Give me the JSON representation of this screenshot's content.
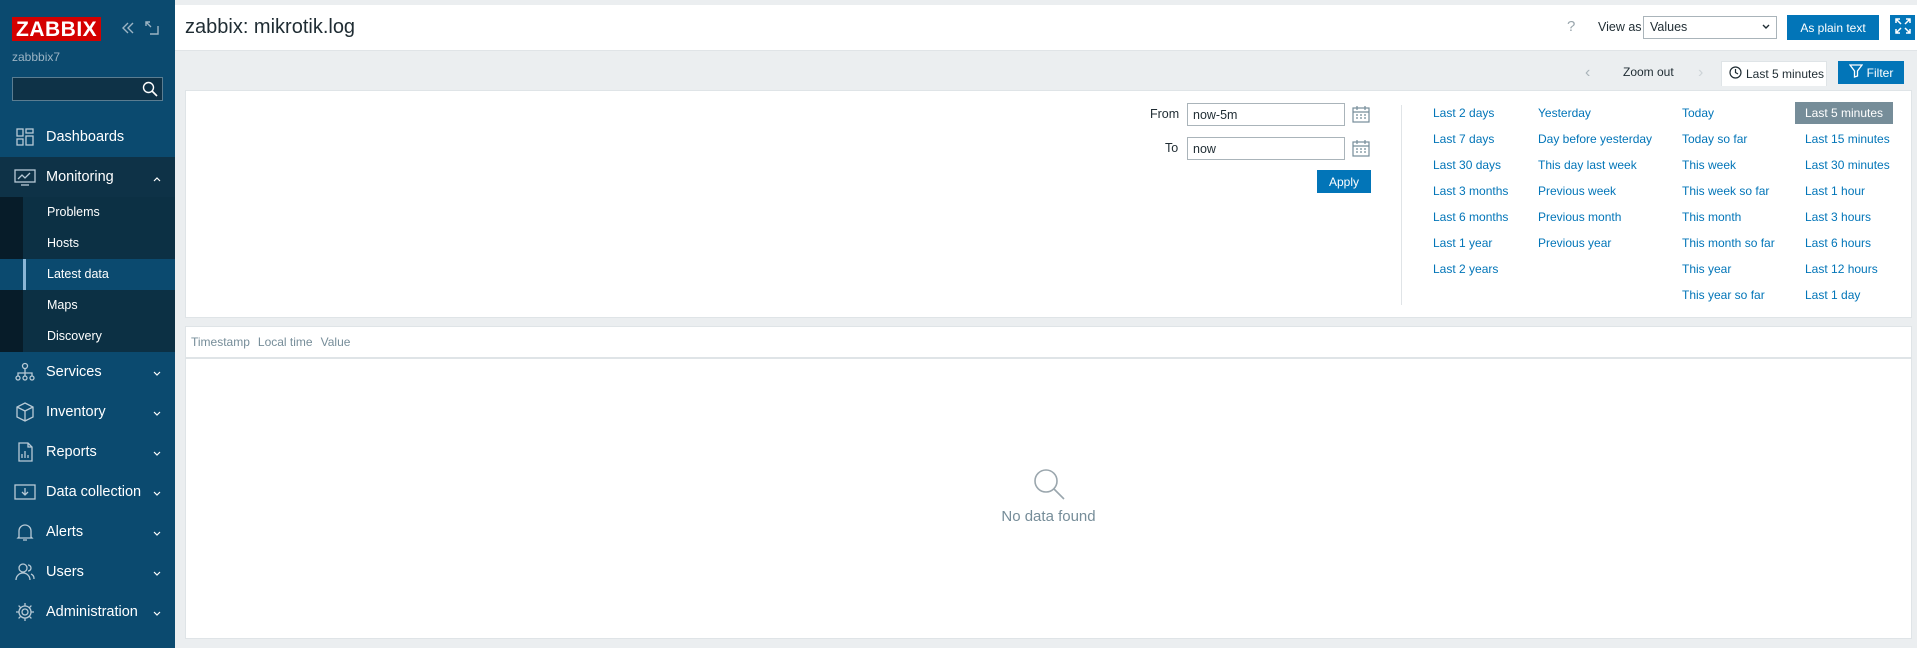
{
  "sidebar": {
    "logo": "ZABBIX",
    "server_name": "zabbbix7",
    "search_placeholder": "",
    "items": [
      {
        "label": "Dashboards",
        "icon": "dashboards-icon"
      },
      {
        "label": "Monitoring",
        "icon": "monitoring-icon",
        "expanded": true,
        "children": [
          "Problems",
          "Hosts",
          "Latest data",
          "Maps",
          "Discovery"
        ],
        "active_child": "Latest data"
      },
      {
        "label": "Services",
        "icon": "services-icon"
      },
      {
        "label": "Inventory",
        "icon": "inventory-icon"
      },
      {
        "label": "Reports",
        "icon": "reports-icon"
      },
      {
        "label": "Data collection",
        "icon": "data-collection-icon"
      },
      {
        "label": "Alerts",
        "icon": "alerts-icon"
      },
      {
        "label": "Users",
        "icon": "users-icon"
      },
      {
        "label": "Administration",
        "icon": "administration-icon"
      }
    ]
  },
  "header": {
    "title": "zabbix: mikrotik.log",
    "help": "?",
    "view_as_label": "View as",
    "view_as_value": "Values",
    "plain_text_label": "As plain text"
  },
  "timebar": {
    "zoom_out": "Zoom out",
    "range_label": "Last 5 minutes",
    "filter_label": "Filter"
  },
  "filter": {
    "from_label": "From",
    "from_value": "now-5m",
    "to_label": "To",
    "to_value": "now",
    "apply_label": "Apply",
    "quick_ranges": [
      [
        "Last 2 days",
        "Last 7 days",
        "Last 30 days",
        "Last 3 months",
        "Last 6 months",
        "Last 1 year",
        "Last 2 years"
      ],
      [
        "Yesterday",
        "Day before yesterday",
        "This day last week",
        "Previous week",
        "Previous month",
        "Previous year"
      ],
      [
        "Today",
        "Today so far",
        "This week",
        "This week so far",
        "This month",
        "This month so far",
        "This year",
        "This year so far"
      ],
      [
        "Last 5 minutes",
        "Last 15 minutes",
        "Last 30 minutes",
        "Last 1 hour",
        "Last 3 hours",
        "Last 6 hours",
        "Last 12 hours",
        "Last 1 day"
      ]
    ],
    "selected_range": "Last 5 minutes"
  },
  "table": {
    "columns": [
      "Timestamp",
      "Local time",
      "Value"
    ],
    "empty_text": "No data found"
  },
  "colors": {
    "sidebar_bg": "#0b4a6f",
    "accent": "#0275b8",
    "logo_red": "#d40000"
  }
}
